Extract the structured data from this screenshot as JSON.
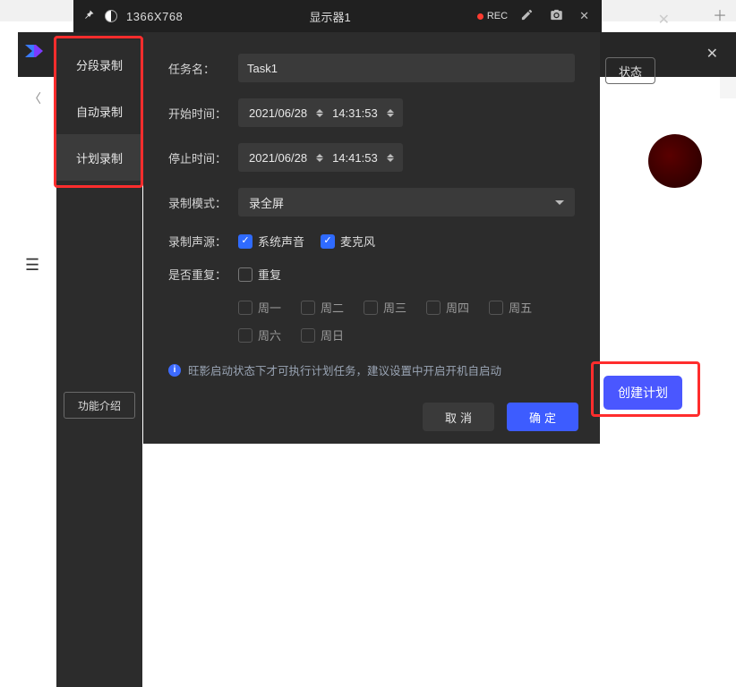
{
  "topbar": {
    "resolution": "1366X768",
    "display_title": "显示器1",
    "rec_label": "REC"
  },
  "sidebar": {
    "items": [
      {
        "label": "分段录制"
      },
      {
        "label": "自动录制"
      },
      {
        "label": "计划录制"
      }
    ],
    "func_label": "功能介绍"
  },
  "status_button": "状态",
  "form": {
    "task_name_label": "任务名：",
    "task_name_value": "Task1",
    "start_time_label": "开始时间：",
    "start_date": "2021/06/28",
    "start_time": "14:31:53",
    "end_time_label": "停止时间：",
    "end_date": "2021/06/28",
    "end_time": "14:41:53",
    "mode_label": "录制模式：",
    "mode_value": "录全屏",
    "audio_label": "录制声源：",
    "audio_system": "系统声音",
    "audio_mic": "麦克风",
    "repeat_label": "是否重复：",
    "repeat_value": "重复",
    "days": [
      "周一",
      "周二",
      "周三",
      "周四",
      "周五",
      "周六",
      "周日"
    ],
    "info_text": "旺影启动状态下才可执行计划任务，建议设置中开启开机自启动",
    "cancel": "取消",
    "confirm": "确定"
  },
  "create_plan": "创建计划"
}
